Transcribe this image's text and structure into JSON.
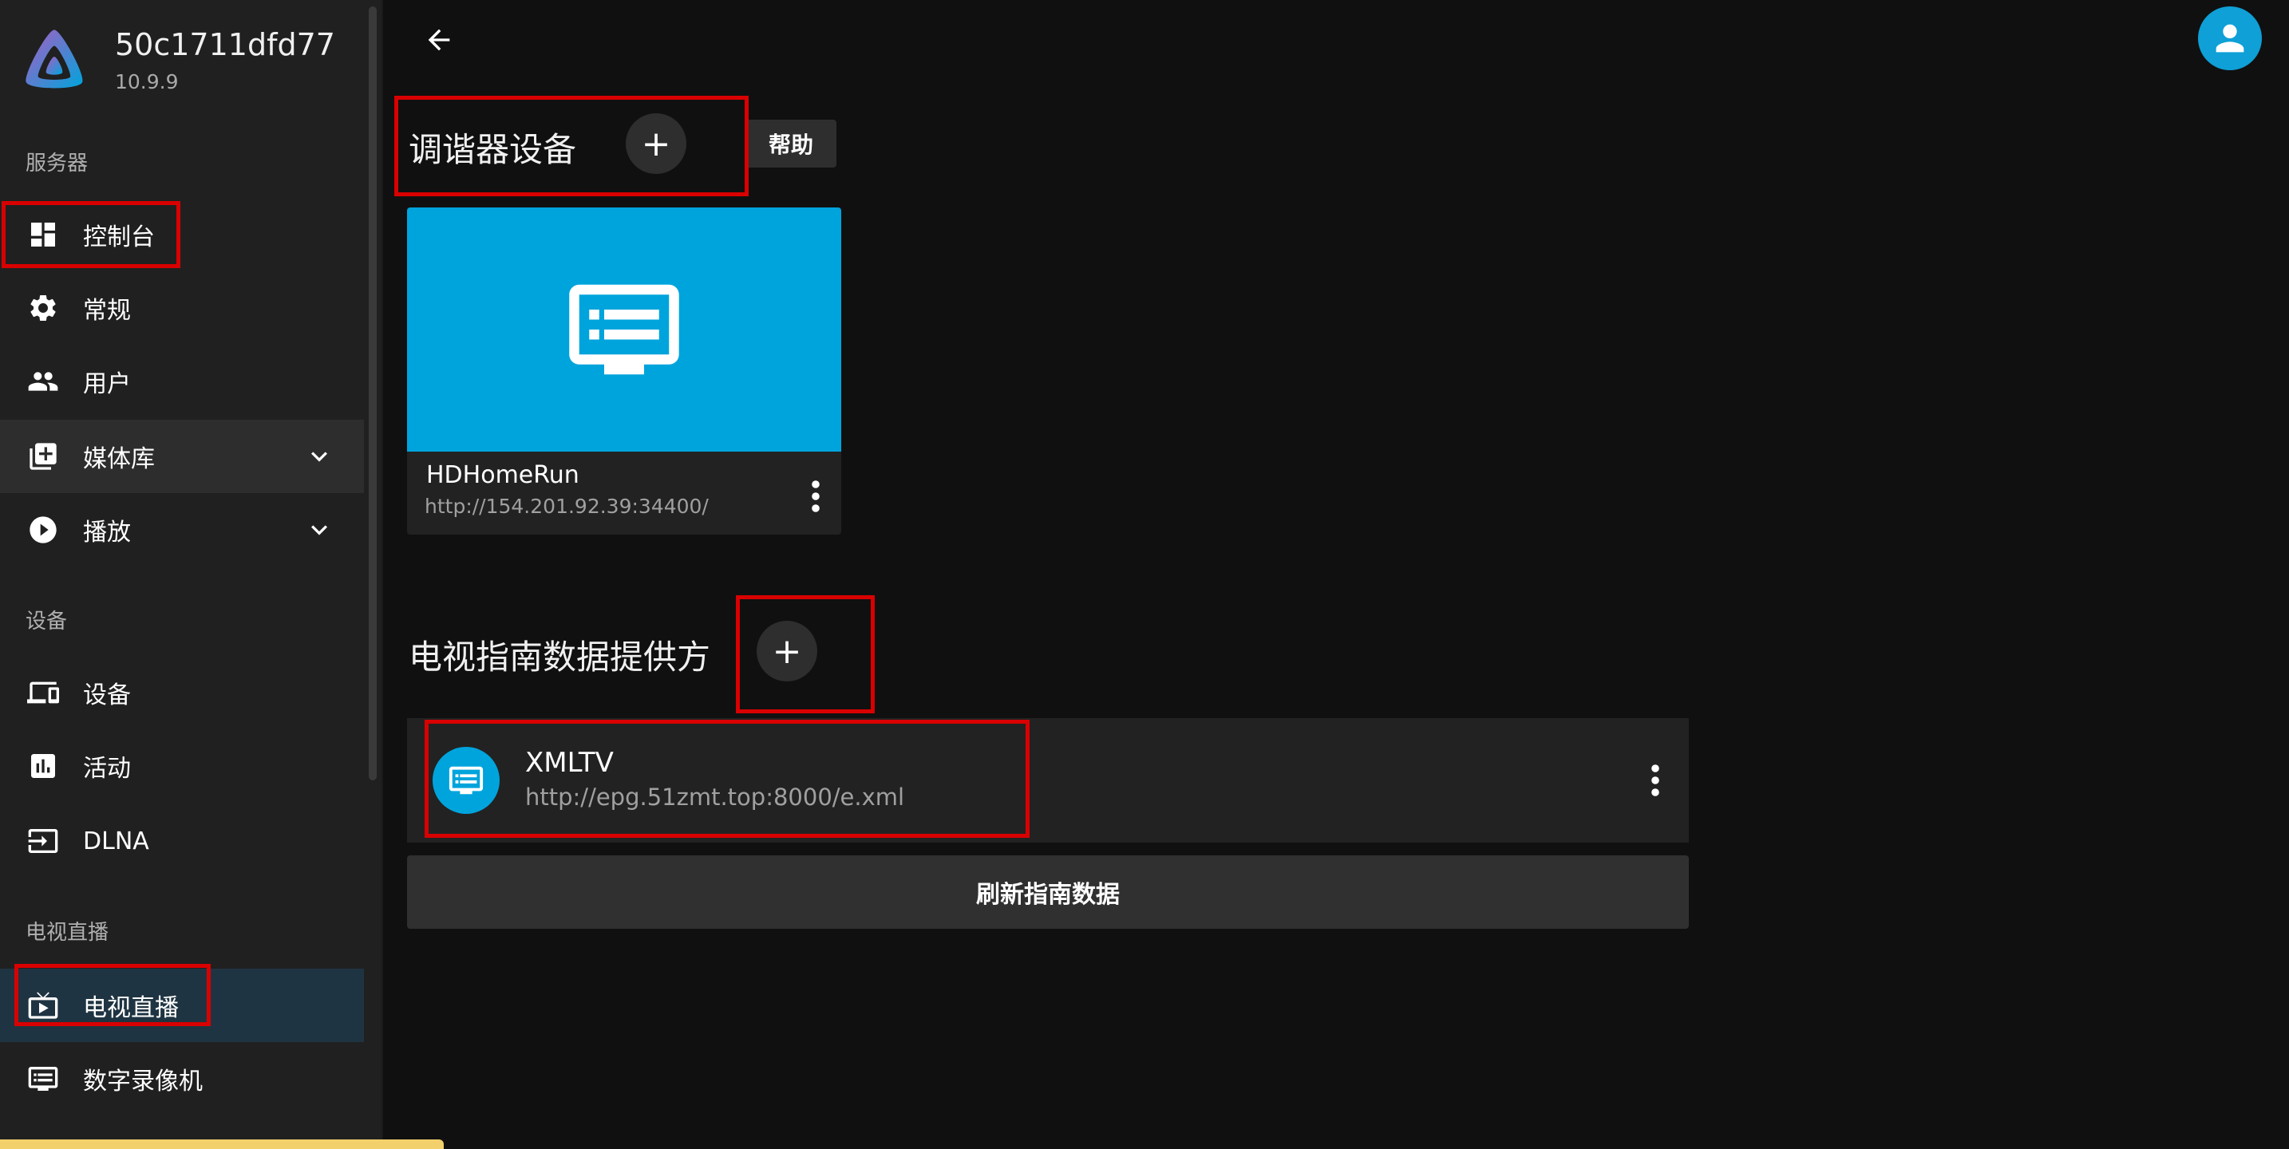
{
  "server": {
    "name": "50c1711dfd77",
    "version": "10.9.9"
  },
  "sidebar": {
    "section_server": "服务器",
    "item_dashboard": "控制台",
    "item_general": "常规",
    "item_users": "用户",
    "item_libraries": "媒体库",
    "item_playback": "播放",
    "section_devices": "设备",
    "item_devices": "设备",
    "item_activity": "活动",
    "item_dlna": "DLNA",
    "section_livetv": "电视直播",
    "item_livetv": "电视直播",
    "item_dvr": "数字录像机"
  },
  "tuners": {
    "title": "调谐器设备",
    "add_symbol": "+",
    "help_label": "帮助",
    "items": [
      {
        "name": "HDHomeRun",
        "url": "http://154.201.92.39:34400/"
      }
    ]
  },
  "guide": {
    "title": "电视指南数据提供方",
    "add_symbol": "+",
    "providers": [
      {
        "name": "XMLTV",
        "url": "http://epg.51zmt.top:8000/e.xml"
      }
    ],
    "refresh_label": "刷新指南数据"
  },
  "colors": {
    "accent": "#00a4dc",
    "highlight_box": "#d90000",
    "background": "#101010",
    "sidebar": "#202020"
  },
  "icons": {
    "logo": "jellyfin-logo-icon",
    "dashboard": "dashboard-icon",
    "general": "gear-icon",
    "users": "people-icon",
    "libraries": "library-add-icon",
    "playback": "play-circle-icon",
    "devices": "devices-icon",
    "activity": "insights-icon",
    "dlna": "input-icon",
    "livetv": "live-tv-icon",
    "dvr": "dvr-icon",
    "back": "arrow-back-icon",
    "avatar": "account-icon"
  }
}
